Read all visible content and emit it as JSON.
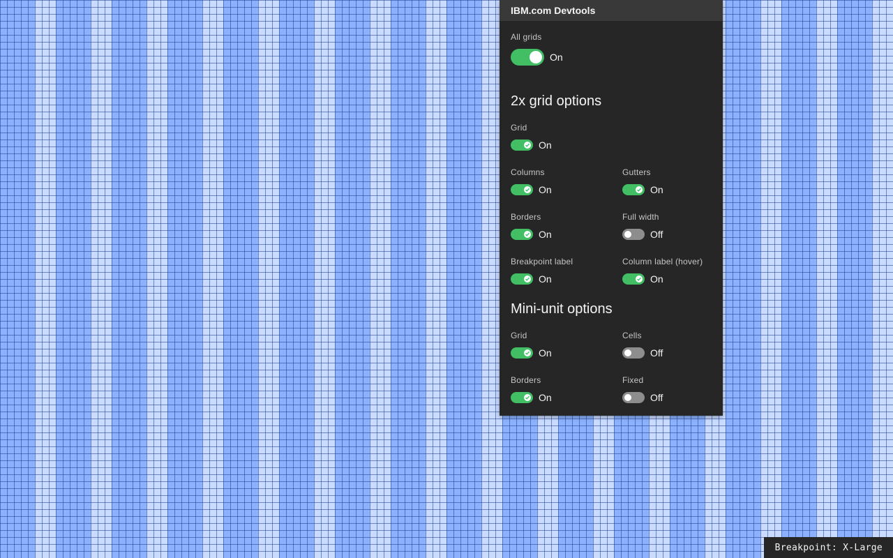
{
  "devtools": {
    "title": "IBM.com Devtools",
    "all_grids": {
      "label": "All grids",
      "state": "On"
    },
    "grid2x": {
      "title": "2x grid options",
      "grid": {
        "label": "Grid",
        "state": "On"
      },
      "columns": {
        "label": "Columns",
        "state": "On"
      },
      "gutters": {
        "label": "Gutters",
        "state": "On"
      },
      "borders": {
        "label": "Borders",
        "state": "On"
      },
      "full_width": {
        "label": "Full width",
        "state": "Off"
      },
      "breakpoint_label": {
        "label": "Breakpoint label",
        "state": "On"
      },
      "column_label": {
        "label": "Column label (hover)",
        "state": "On"
      }
    },
    "mini_unit": {
      "title": "Mini-unit options",
      "grid": {
        "label": "Grid",
        "state": "On"
      },
      "cells": {
        "label": "Cells",
        "state": "Off"
      },
      "borders": {
        "label": "Borders",
        "state": "On"
      },
      "fixed": {
        "label": "Fixed",
        "state": "Off"
      }
    }
  },
  "breakpoint": "Breakpoint: X-Large",
  "colors": {
    "column": "#8cb2ff",
    "gutter": "#c9dbff",
    "toggle_on": "#42be65",
    "toggle_off": "#8d8d8d",
    "panel_bg": "#262626"
  }
}
